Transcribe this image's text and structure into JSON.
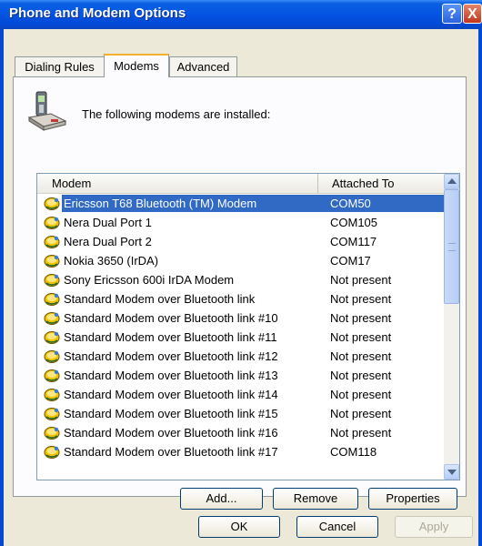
{
  "window": {
    "title": "Phone and Modem Options",
    "help_glyph": "?",
    "close_glyph": "X"
  },
  "tabs": [
    {
      "label": "Dialing Rules",
      "active": false
    },
    {
      "label": "Modems",
      "active": true
    },
    {
      "label": "Advanced",
      "active": false
    }
  ],
  "intro_text": "The following modems are installed:",
  "list": {
    "columns": {
      "modem": "Modem",
      "attached_to": "Attached To"
    },
    "rows": [
      {
        "modem": "Ericsson T68 Bluetooth (TM) Modem",
        "port": "COM50",
        "selected": true
      },
      {
        "modem": "Nera Dual Port 1",
        "port": "COM105"
      },
      {
        "modem": "Nera Dual Port 2",
        "port": "COM117"
      },
      {
        "modem": "Nokia 3650 (IrDA)",
        "port": "COM17"
      },
      {
        "modem": "Sony Ericsson 600i IrDA Modem",
        "port": "Not present"
      },
      {
        "modem": "Standard Modem over Bluetooth link",
        "port": "Not present"
      },
      {
        "modem": "Standard Modem over Bluetooth link #10",
        "port": "Not present"
      },
      {
        "modem": "Standard Modem over Bluetooth link #11",
        "port": "Not present"
      },
      {
        "modem": "Standard Modem over Bluetooth link #12",
        "port": "Not present"
      },
      {
        "modem": "Standard Modem over Bluetooth link #13",
        "port": "Not present"
      },
      {
        "modem": "Standard Modem over Bluetooth link #14",
        "port": "Not present"
      },
      {
        "modem": "Standard Modem over Bluetooth link #15",
        "port": "Not present"
      },
      {
        "modem": "Standard Modem over Bluetooth link #16",
        "port": "Not present"
      },
      {
        "modem": "Standard Modem over Bluetooth link #17",
        "port": "COM118"
      }
    ]
  },
  "buttons": {
    "add": "Add...",
    "remove": "Remove",
    "properties": "Properties",
    "ok": "OK",
    "cancel": "Cancel",
    "apply": "Apply"
  },
  "colors": {
    "titlebar": "#0554e3",
    "selection": "#316ac5",
    "face": "#ece9d8"
  }
}
